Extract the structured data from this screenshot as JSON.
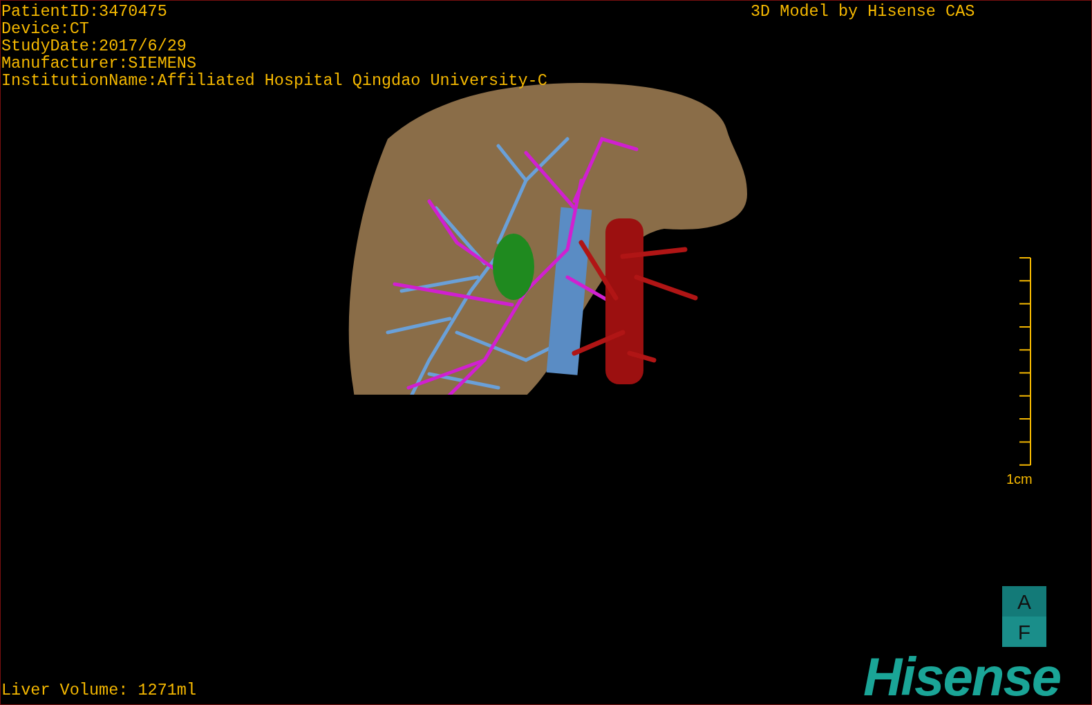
{
  "patient_info": [
    "PatientID:3470475",
    "Device:CT",
    "StudyDate:2017/6/29",
    "Manufacturer:SIEMENS",
    "InstitutionName:Affiliated Hospital Qingdao University-C"
  ],
  "model_credit": "3D Model by Hisense CAS",
  "scale_bar": {
    "label": "1cm"
  },
  "orientation_cube": {
    "top_face": "A",
    "bottom_face": "F"
  },
  "liver_volume": "Liver Volume: 1271ml",
  "logo": "Hisense"
}
